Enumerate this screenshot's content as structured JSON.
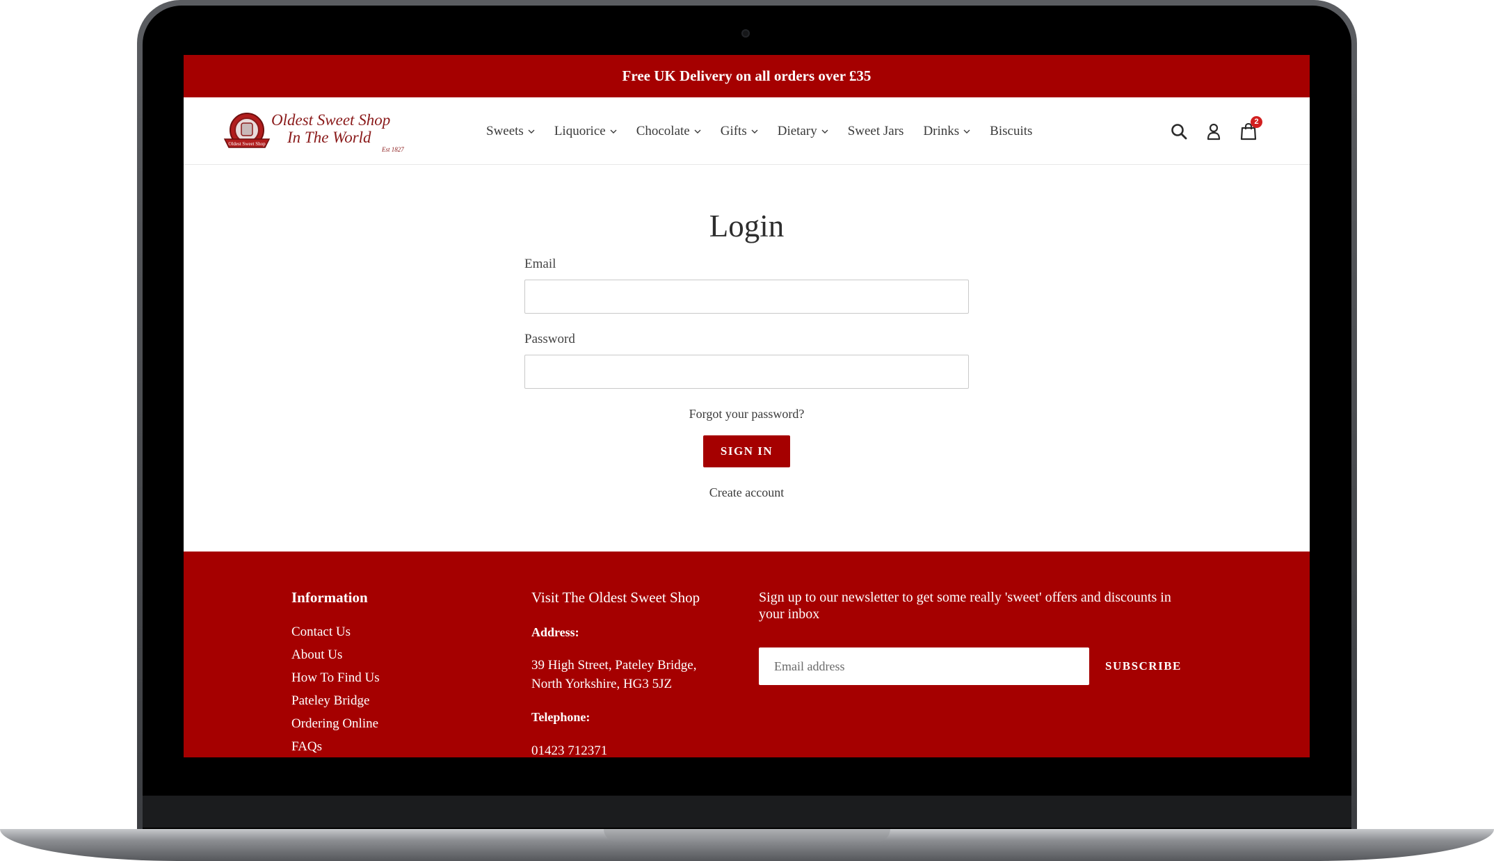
{
  "announcement": {
    "text": "Free UK Delivery on all orders over £35"
  },
  "logo": {
    "line1": "Oldest Sweet Shop",
    "line2": "In The World",
    "est": "Est 1827",
    "badge_text": "Oldest Sweet Shop"
  },
  "nav": {
    "items": [
      {
        "label": "Sweets",
        "has_dropdown": true
      },
      {
        "label": "Liquorice",
        "has_dropdown": true
      },
      {
        "label": "Chocolate",
        "has_dropdown": true
      },
      {
        "label": "Gifts",
        "has_dropdown": true
      },
      {
        "label": "Dietary",
        "has_dropdown": true
      },
      {
        "label": "Sweet Jars",
        "has_dropdown": false
      },
      {
        "label": "Drinks",
        "has_dropdown": true
      },
      {
        "label": "Biscuits",
        "has_dropdown": false
      }
    ]
  },
  "header_icons": {
    "search": "search-icon",
    "account": "user-icon",
    "cart": "shopping-bag-icon",
    "cart_count": "2"
  },
  "login": {
    "title": "Login",
    "email_label": "Email",
    "email_value": "",
    "password_label": "Password",
    "password_value": "",
    "forgot_link": "Forgot your password?",
    "signin_button": "SIGN IN",
    "create_account_link": "Create account"
  },
  "footer": {
    "information": {
      "heading": "Information",
      "links": [
        "Contact Us",
        "About Us",
        "How To Find Us",
        "Pateley Bridge",
        "Ordering Online",
        "FAQs"
      ]
    },
    "visit": {
      "heading": "Visit The Oldest Sweet Shop",
      "address_label": "Address:",
      "address_line1": "39 High Street, Pateley Bridge,",
      "address_line2": "North Yorkshire, HG3 5JZ",
      "telephone_label": "Telephone:",
      "telephone": "01423 712371"
    },
    "newsletter": {
      "text": "Sign up to our newsletter to get some really 'sweet' offers and discounts in your inbox",
      "email_placeholder": "Email address",
      "subscribe_button": "SUBSCRIBE"
    }
  },
  "colors": {
    "brand_red": "#a50000",
    "badge_red": "#d21f1f",
    "text_dark": "#3a3a3a"
  }
}
